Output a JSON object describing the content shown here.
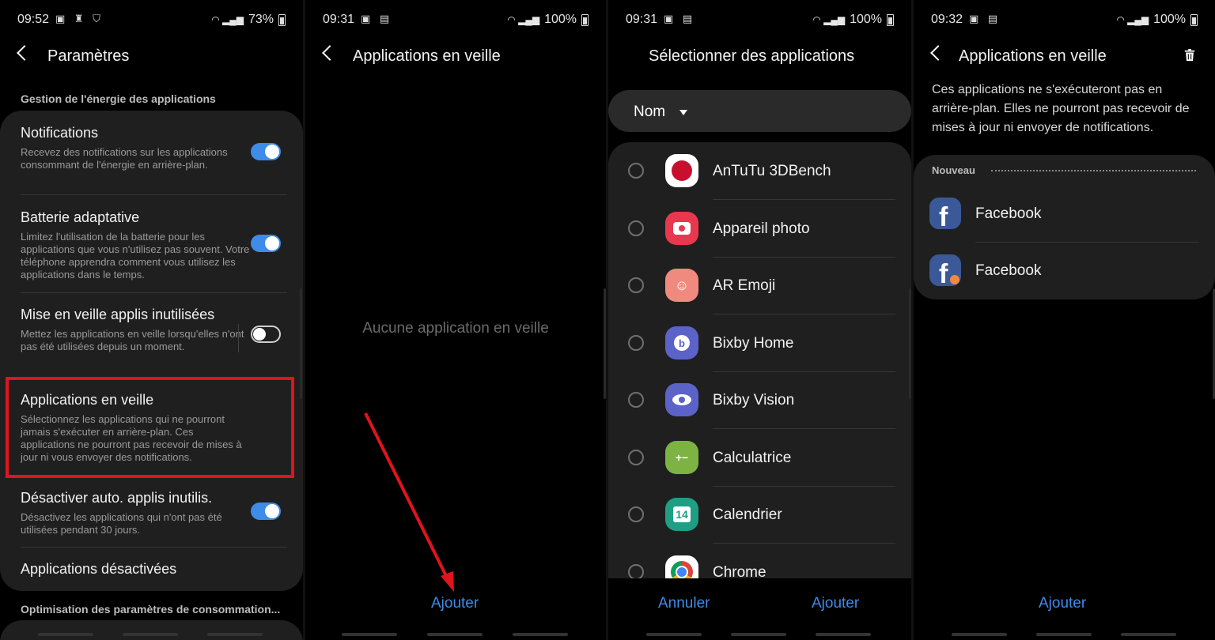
{
  "panel1": {
    "status": {
      "time": "09:52",
      "battery": "73%"
    },
    "title": "Paramètres",
    "section_label": "Gestion de l'énergie des applications",
    "items": [
      {
        "title": "Notifications",
        "desc": "Recevez des notifications sur les applications consommant de l'énergie en arrière-plan.",
        "toggle": "on"
      },
      {
        "title": "Batterie adaptative",
        "desc": "Limitez l'utilisation de la batterie pour les applications que vous n'utilisez pas souvent. Votre téléphone apprendra comment vous utilisez les applications dans le temps.",
        "toggle": "on"
      },
      {
        "title": "Mise en veille applis inutilisées",
        "desc": "Mettez les applications en veille lorsqu'elles n'ont pas été utilisées depuis un moment.",
        "toggle": "off"
      },
      {
        "title": "Applications en veille",
        "desc": "Sélectionnez les applications qui ne pourront jamais s'exécuter en arrière-plan. Ces applications ne pourront pas recevoir de mises à jour ni vous envoyer des notifications."
      },
      {
        "title": "Désactiver auto. applis inutilis.",
        "desc": "Désactivez les applications qui n'ont pas été utilisées pendant 30 jours.",
        "toggle": "on"
      },
      {
        "title": "Applications désactivées"
      }
    ],
    "footer_label": "Optimisation des paramètres de consommation..."
  },
  "panel2": {
    "status": {
      "time": "09:31",
      "battery": "100%"
    },
    "title": "Applications en veille",
    "empty_text": "Aucune application en veille",
    "add_label": "Ajouter"
  },
  "panel3": {
    "status": {
      "time": "09:31",
      "battery": "100%"
    },
    "title": "Sélectionner des applications",
    "sort_label": "Nom",
    "apps": [
      {
        "name": "AnTuTu 3DBench",
        "icon": "antutu-icon",
        "color": "#ffffff"
      },
      {
        "name": "Appareil photo",
        "icon": "camera-icon",
        "color": "#e8384f"
      },
      {
        "name": "AR Emoji",
        "icon": "ar-emoji-icon",
        "color": "#f08a7f"
      },
      {
        "name": "Bixby Home",
        "icon": "bixby-home-icon",
        "color": "#5b63c9"
      },
      {
        "name": "Bixby Vision",
        "icon": "bixby-vision-icon",
        "color": "#5b63c9"
      },
      {
        "name": "Calculatrice",
        "icon": "calculator-icon",
        "color": "#7cb342"
      },
      {
        "name": "Calendrier",
        "icon": "calendar-icon",
        "color": "#1f9e83",
        "glyph": "14"
      },
      {
        "name": "Chrome",
        "icon": "chrome-icon",
        "color": "#ffffff"
      }
    ],
    "cancel_label": "Annuler",
    "add_label": "Ajouter"
  },
  "panel4": {
    "status": {
      "time": "09:32",
      "battery": "100%"
    },
    "title": "Applications en veille",
    "description": "Ces applications ne s'exécuteront pas en arrière-plan. Elles ne pourront pas recevoir de mises à jour ni envoyer de notifications.",
    "group_label": "Nouveau",
    "apps": [
      {
        "name": "Facebook",
        "icon": "facebook-icon"
      },
      {
        "name": "Facebook",
        "icon": "facebook-icon"
      }
    ],
    "add_label": "Ajouter"
  },
  "colors": {
    "accent": "#3e8be8",
    "highlight": "#e1141b",
    "card": "#1f1f1f"
  }
}
